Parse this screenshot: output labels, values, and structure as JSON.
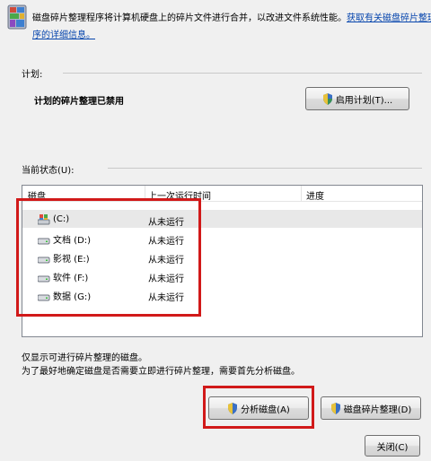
{
  "intro": {
    "text": "磁盘碎片整理程序将计算机硬盘上的碎片文件进行合并，以改进文件系统性能。",
    "link_part1": "获取有关磁盘碎片整理程",
    "link_part2": "序的详细信息。"
  },
  "schedule": {
    "section_label": "计划:",
    "status": "计划的碎片整理已禁用",
    "enable_button": "启用计划(T)..."
  },
  "current_status": {
    "section_label": "当前状态(U):",
    "columns": {
      "disk": "磁盘",
      "last_run": "上一次运行时间",
      "progress": "进度"
    },
    "disks": [
      {
        "label": "(C:)",
        "last_run": "从未运行",
        "icon": "system-drive-icon"
      },
      {
        "label": "文档 (D:)",
        "last_run": "从未运行",
        "icon": "hard-drive-icon"
      },
      {
        "label": "影视 (E:)",
        "last_run": "从未运行",
        "icon": "hard-drive-icon"
      },
      {
        "label": "软件 (F:)",
        "last_run": "从未运行",
        "icon": "hard-drive-icon"
      },
      {
        "label": "数据 (G:)",
        "last_run": "从未运行",
        "icon": "hard-drive-icon"
      }
    ]
  },
  "notes": {
    "line1": "仅显示可进行碎片整理的磁盘。",
    "line2": "为了最好地确定磁盘是否需要立即进行碎片整理，需要首先分析磁盘。"
  },
  "actions": {
    "analyze_button": "分析磁盘(A)",
    "defrag_button": "磁盘碎片整理(D)",
    "close_button": "关闭(C)"
  },
  "colors": {
    "highlight": "#d11919",
    "link": "#0645ad"
  }
}
